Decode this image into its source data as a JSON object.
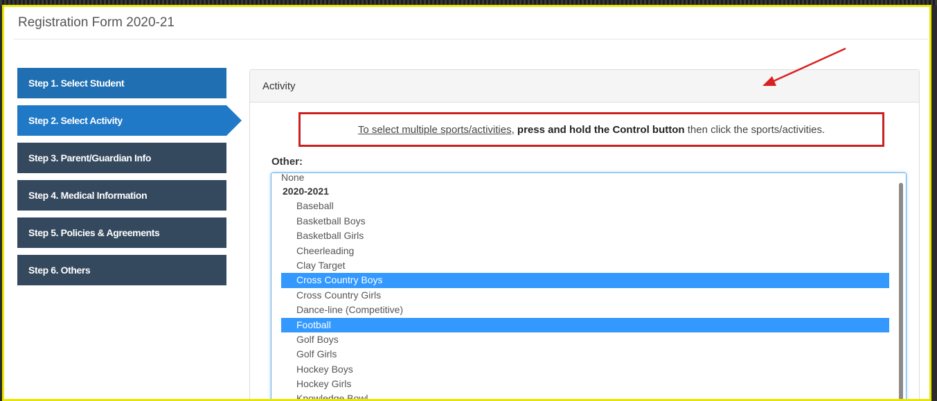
{
  "form": {
    "title": "Registration Form 2020-21"
  },
  "steps": [
    {
      "label": "Step 1. Select Student",
      "state": "done"
    },
    {
      "label": "Step 2. Select Activity",
      "state": "active"
    },
    {
      "label": "Step 3. Parent/Guardian Info",
      "state": "pending"
    },
    {
      "label": "Step 4. Medical Information",
      "state": "pending"
    },
    {
      "label": "Step 5. Policies & Agreements",
      "state": "pending"
    },
    {
      "label": "Step 6. Others",
      "state": "pending"
    }
  ],
  "panel": {
    "heading": "Activity",
    "notice": {
      "part1": "To select multiple sports/activities,",
      "part2": "press and hold the Control button",
      "part3": "then click the sports/activities."
    },
    "field_label": "Other:",
    "options": [
      {
        "label": "None",
        "kind": "none",
        "selected": false
      },
      {
        "label": "2020-2021",
        "kind": "group",
        "selected": false
      },
      {
        "label": "Baseball",
        "kind": "option",
        "selected": false
      },
      {
        "label": "Basketball Boys",
        "kind": "option",
        "selected": false
      },
      {
        "label": "Basketball Girls",
        "kind": "option",
        "selected": false
      },
      {
        "label": "Cheerleading",
        "kind": "option",
        "selected": false
      },
      {
        "label": "Clay Target",
        "kind": "option",
        "selected": false
      },
      {
        "label": "Cross Country Boys",
        "kind": "option",
        "selected": true
      },
      {
        "label": "Cross Country Girls",
        "kind": "option",
        "selected": false
      },
      {
        "label": "Dance-line (Competitive)",
        "kind": "option",
        "selected": false
      },
      {
        "label": "Football",
        "kind": "option",
        "selected": true
      },
      {
        "label": "Golf Boys",
        "kind": "option",
        "selected": false
      },
      {
        "label": "Golf Girls",
        "kind": "option",
        "selected": false
      },
      {
        "label": "Hockey Boys",
        "kind": "option",
        "selected": false
      },
      {
        "label": "Hockey Girls",
        "kind": "option",
        "selected": false
      },
      {
        "label": "Knowledge Bowl",
        "kind": "option",
        "selected": false
      }
    ]
  },
  "colors": {
    "step_dark": "#34495e",
    "step_active": "#2079c7",
    "selection": "#3399ff",
    "notice_border": "#cc1f1f",
    "frame_border": "#e8e600"
  },
  "icons": {
    "annotation": "red-arrow-icon"
  }
}
